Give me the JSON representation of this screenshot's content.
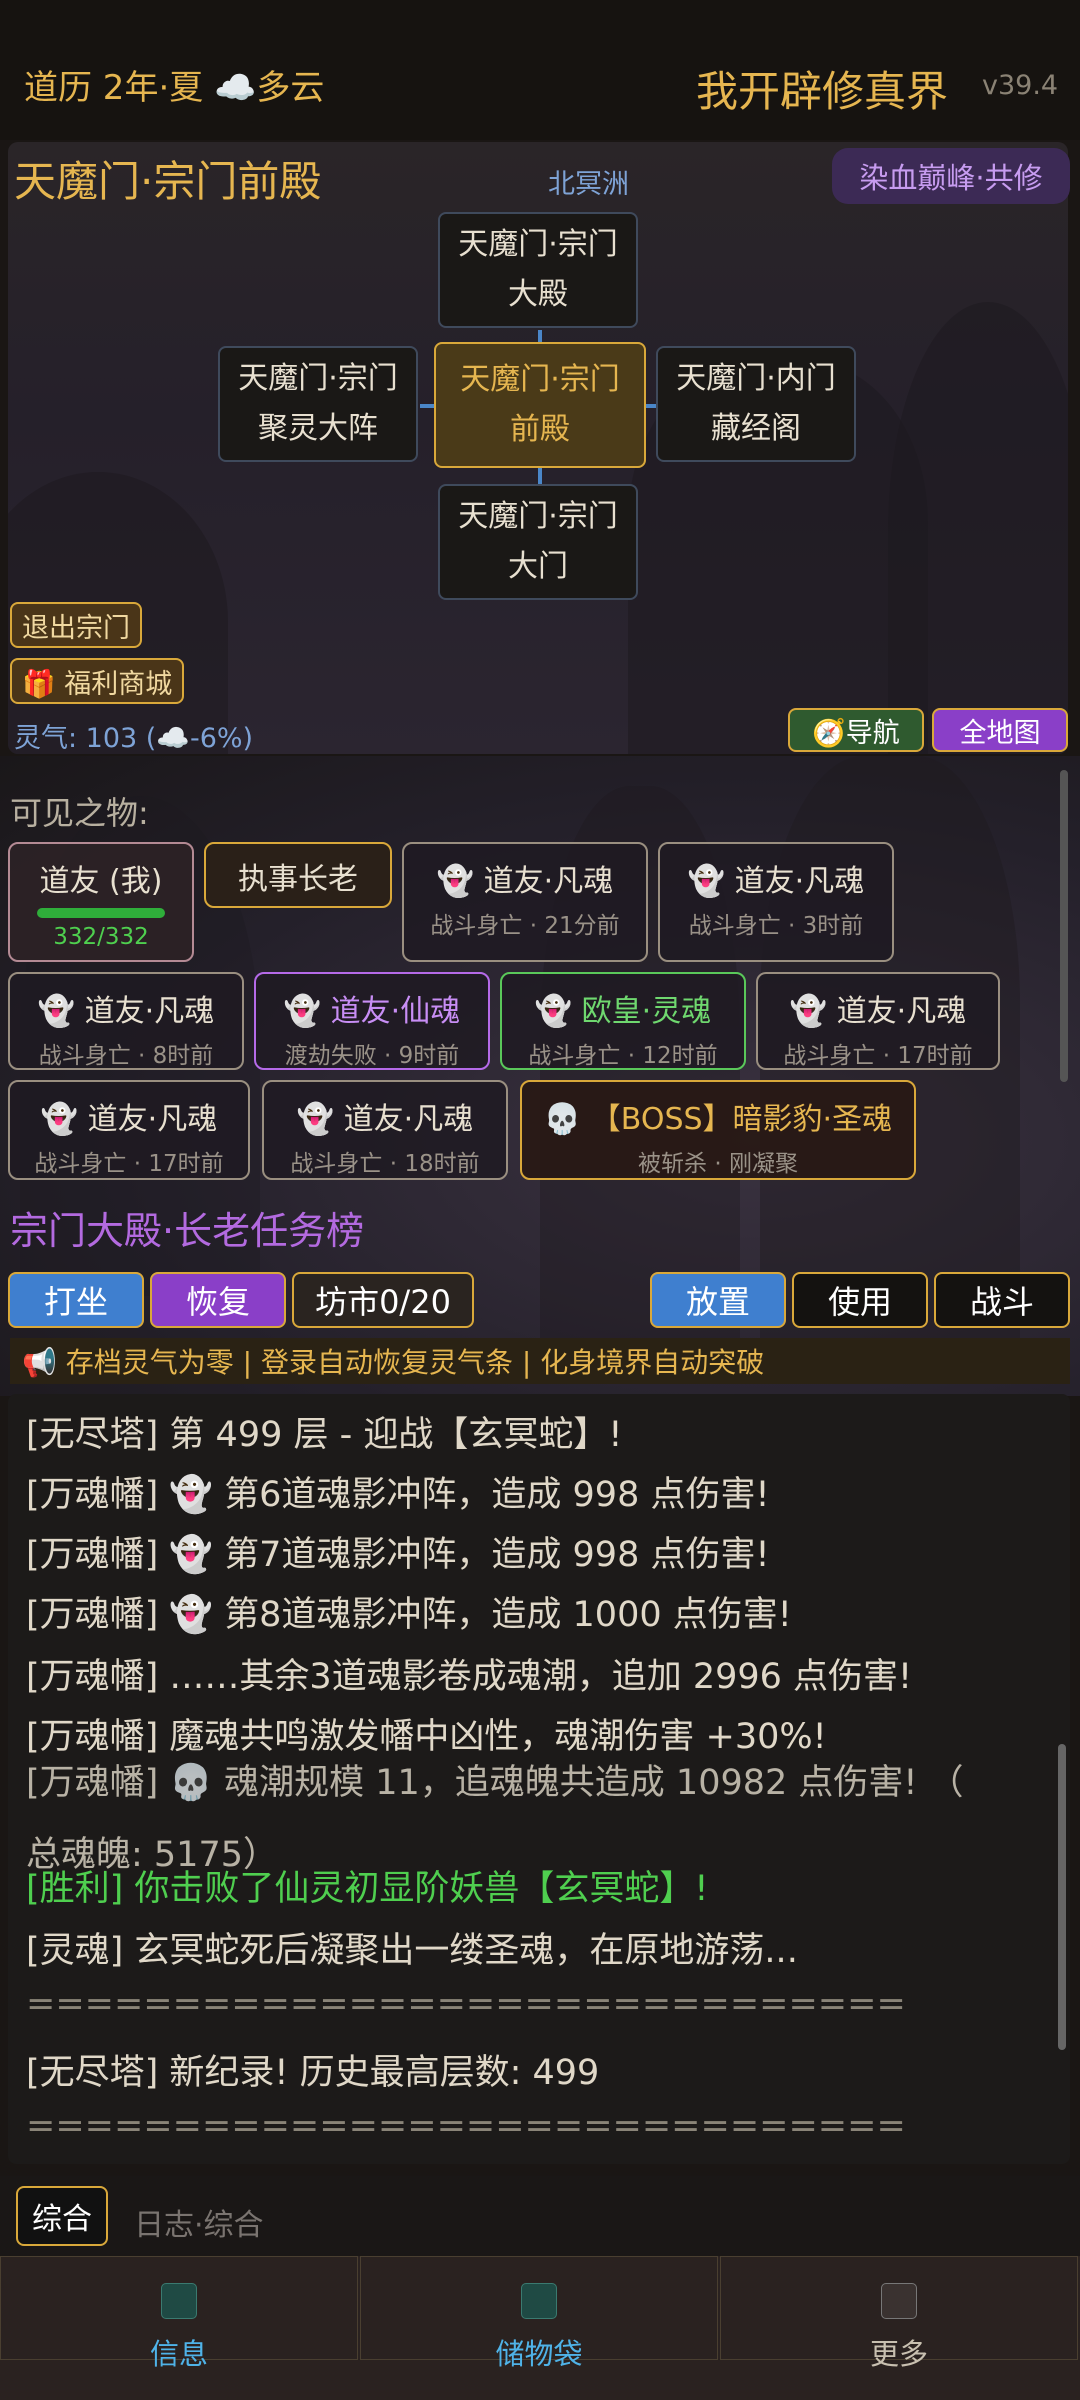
{
  "header": {
    "calendar": "道历 2年·夏 ☁️多云",
    "title": "我开辟修真界",
    "version": "v39.4"
  },
  "map": {
    "location_title": "天魔门·宗门前殿",
    "region": "北冥洲",
    "badge": "染血巅峰·共修",
    "nodes": {
      "north": [
        "天魔门·宗门",
        "大殿"
      ],
      "west": [
        "天魔门·宗门",
        "聚灵大阵"
      ],
      "center": [
        "天魔门·宗门",
        "前殿"
      ],
      "east": [
        "天魔门·内门",
        "藏经阁"
      ],
      "south": [
        "天魔门·宗门",
        "大门"
      ]
    },
    "exit_button": "退出宗门",
    "shop_button": "🎁 福利商城",
    "lingqi": "灵气: 103 (☁️-6%)",
    "nav_button": "🧭导航",
    "fullmap_button": "全地图"
  },
  "scene": {
    "visible_label": "可见之物:",
    "self": {
      "name": "道友 (我)",
      "hp": "332/332",
      "hp_fraction": 1.0
    },
    "elder": "执事长老",
    "cards": [
      {
        "title": "👻 道友·凡魂",
        "sub": "战斗身亡 · 21分前"
      },
      {
        "title": "👻 道友·凡魂",
        "sub": "战斗身亡 · 3时前"
      },
      {
        "title": "👻 道友·凡魂",
        "sub": "战斗身亡 · 8时前"
      },
      {
        "title": "👻 道友·仙魂",
        "sub": "渡劫失败 · 9时前"
      },
      {
        "title": "👻 欧皇·灵魂",
        "sub": "战斗身亡 · 12时前"
      },
      {
        "title": "👻 道友·凡魂",
        "sub": "战斗身亡 · 17时前"
      },
      {
        "title": "👻 道友·凡魂",
        "sub": "战斗身亡 · 17时前"
      },
      {
        "title": "👻 道友·凡魂",
        "sub": "战斗身亡 · 18时前"
      },
      {
        "title": "💀 【BOSS】暗影豹·圣魂",
        "sub": "被斩杀 · 刚凝聚"
      }
    ],
    "task_title": "宗门大殿·长老任务榜"
  },
  "actions": {
    "meditate": "打坐",
    "recover": "恢复",
    "market": "坊市0/20",
    "place": "放置",
    "use": "使用",
    "fight": "战斗"
  },
  "ticker": "📢 存档灵气为零 | 登录自动恢复灵气条 | 化身境界自动突破",
  "log": [
    "[无尽塔] 第 499 层 - 迎战【玄冥蛇】!",
    "[万魂幡] 👻 第6道魂影冲阵，造成 998 点伤害!",
    "[万魂幡] 👻 第7道魂影冲阵，造成 998 点伤害!",
    "[万魂幡] 👻 第8道魂影冲阵，造成 1000 点伤害!",
    "[万魂幡] ……其余3道魂影卷成魂潮，追加 2996 点伤害!",
    "[万魂幡] 魔魂共鸣激发幡中凶性，魂潮伤害 +30%!",
    "[万魂幡] 💀 魂潮规模 11，追魂魄共造成 10982 点伤害! （",
    "总魂魄: 5175）",
    "[胜利] 你击败了仙灵初显阶妖兽【玄冥蛇】!",
    "[灵魂] 玄冥蛇死后凝聚出一缕圣魂，在原地游荡...",
    "==============================",
    "[无尽塔] 新纪录! 历史最高层数: 499",
    "=============================="
  ],
  "tabs": {
    "general": "综合",
    "log_general": "日志·综合"
  },
  "bottom_nav": {
    "info": "信息",
    "bag": "储物袋",
    "more": "更多"
  }
}
